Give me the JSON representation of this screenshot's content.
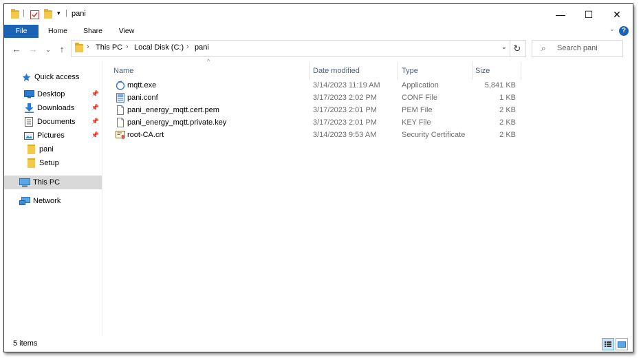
{
  "window": {
    "title": "pani",
    "controls": {
      "minimize": "—",
      "maximize": "☐",
      "close": "✕"
    }
  },
  "ribbon": {
    "tabs": [
      "File",
      "Home",
      "Share",
      "View"
    ],
    "help": "?"
  },
  "address": {
    "crumbs": [
      "This PC",
      "Local Disk (C:)",
      "pani"
    ],
    "search_placeholder": "Search pani"
  },
  "nav": {
    "items": [
      {
        "label": "Quick access",
        "icon": "star-icon",
        "pinned": false
      },
      {
        "label": "Desktop",
        "icon": "desktop-icon",
        "pinned": true
      },
      {
        "label": "Downloads",
        "icon": "download-icon",
        "pinned": true
      },
      {
        "label": "Documents",
        "icon": "documents-icon",
        "pinned": true
      },
      {
        "label": "Pictures",
        "icon": "pictures-icon",
        "pinned": true
      },
      {
        "label": "pani",
        "icon": "folder-icon",
        "pinned": false
      },
      {
        "label": "Setup",
        "icon": "folder-icon",
        "pinned": false
      },
      {
        "label": "This PC",
        "icon": "computer-icon",
        "pinned": false,
        "selected": true
      },
      {
        "label": "Network",
        "icon": "network-icon",
        "pinned": false
      }
    ]
  },
  "columns": {
    "name": "Name",
    "date": "Date modified",
    "type": "Type",
    "size": "Size"
  },
  "files": [
    {
      "name": "mqtt.exe",
      "date": "3/14/2023 11:19 AM",
      "type": "Application",
      "size": "5,841 KB",
      "icon": "application-icon"
    },
    {
      "name": "pani.conf",
      "date": "3/17/2023 2:02 PM",
      "type": "CONF File",
      "size": "1 KB",
      "icon": "config-file-icon"
    },
    {
      "name": "pani_energy_mqtt.cert.pem",
      "date": "3/17/2023 2:01 PM",
      "type": "PEM File",
      "size": "2 KB",
      "icon": "file-icon"
    },
    {
      "name": "pani_energy_mqtt.private.key",
      "date": "3/17/2023 2:01 PM",
      "type": "KEY File",
      "size": "2 KB",
      "icon": "file-icon"
    },
    {
      "name": "root-CA.crt",
      "date": "3/14/2023 9:53 AM",
      "type": "Security Certificate",
      "size": "2 KB",
      "icon": "certificate-icon"
    }
  ],
  "status": {
    "item_count": "5 items"
  },
  "colors": {
    "accent": "#1a63b5",
    "folder": "#f2c94c",
    "selected_bg": "#d9d9d9"
  }
}
